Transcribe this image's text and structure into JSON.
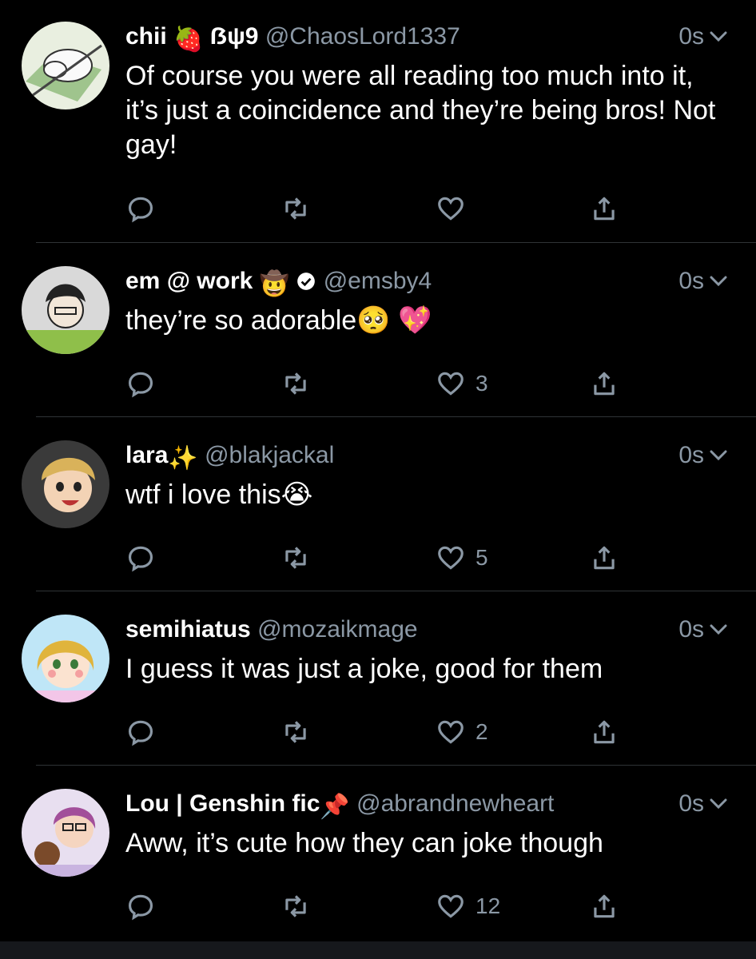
{
  "colors": {
    "background": "#000000",
    "text": "#ffffff",
    "secondary": "#8b98a5",
    "divider": "#2f3336"
  },
  "tweets": [
    {
      "name": "chii",
      "name_suffix": "🍓",
      "extra": "ẞψ9",
      "handle": "@ChaosLord1337",
      "time": "0s",
      "text": "Of course you were all reading too much into it, it’s just a coincidence and they’re being bros! Not gay!",
      "reply_count": "",
      "retweet_count": "",
      "like_count": ""
    },
    {
      "name": "em @ work",
      "name_suffix": "🤠",
      "verified": "verified-icon",
      "handle": "@emsby4",
      "time": "0s",
      "text": "they’re so adorable🥺 💖",
      "reply_count": "",
      "retweet_count": "",
      "like_count": "3"
    },
    {
      "name": "lara",
      "name_suffix": "✨",
      "handle": "@blakjackal",
      "time": "0s",
      "text": "wtf i love this😭",
      "reply_count": "",
      "retweet_count": "",
      "like_count": "5"
    },
    {
      "name": "semihiatus",
      "name_suffix": "",
      "handle": "@mozaikmage",
      "time": "0s",
      "text": "I guess it was just a joke, good for them",
      "reply_count": "",
      "retweet_count": "",
      "like_count": "2"
    },
    {
      "name": "Lou | Genshin fic",
      "name_suffix": "📌",
      "handle": "@abrandnewheart",
      "time": "0s",
      "text": "Aww, it’s cute how they can joke though",
      "reply_count": "",
      "retweet_count": "",
      "like_count": "12"
    }
  ]
}
